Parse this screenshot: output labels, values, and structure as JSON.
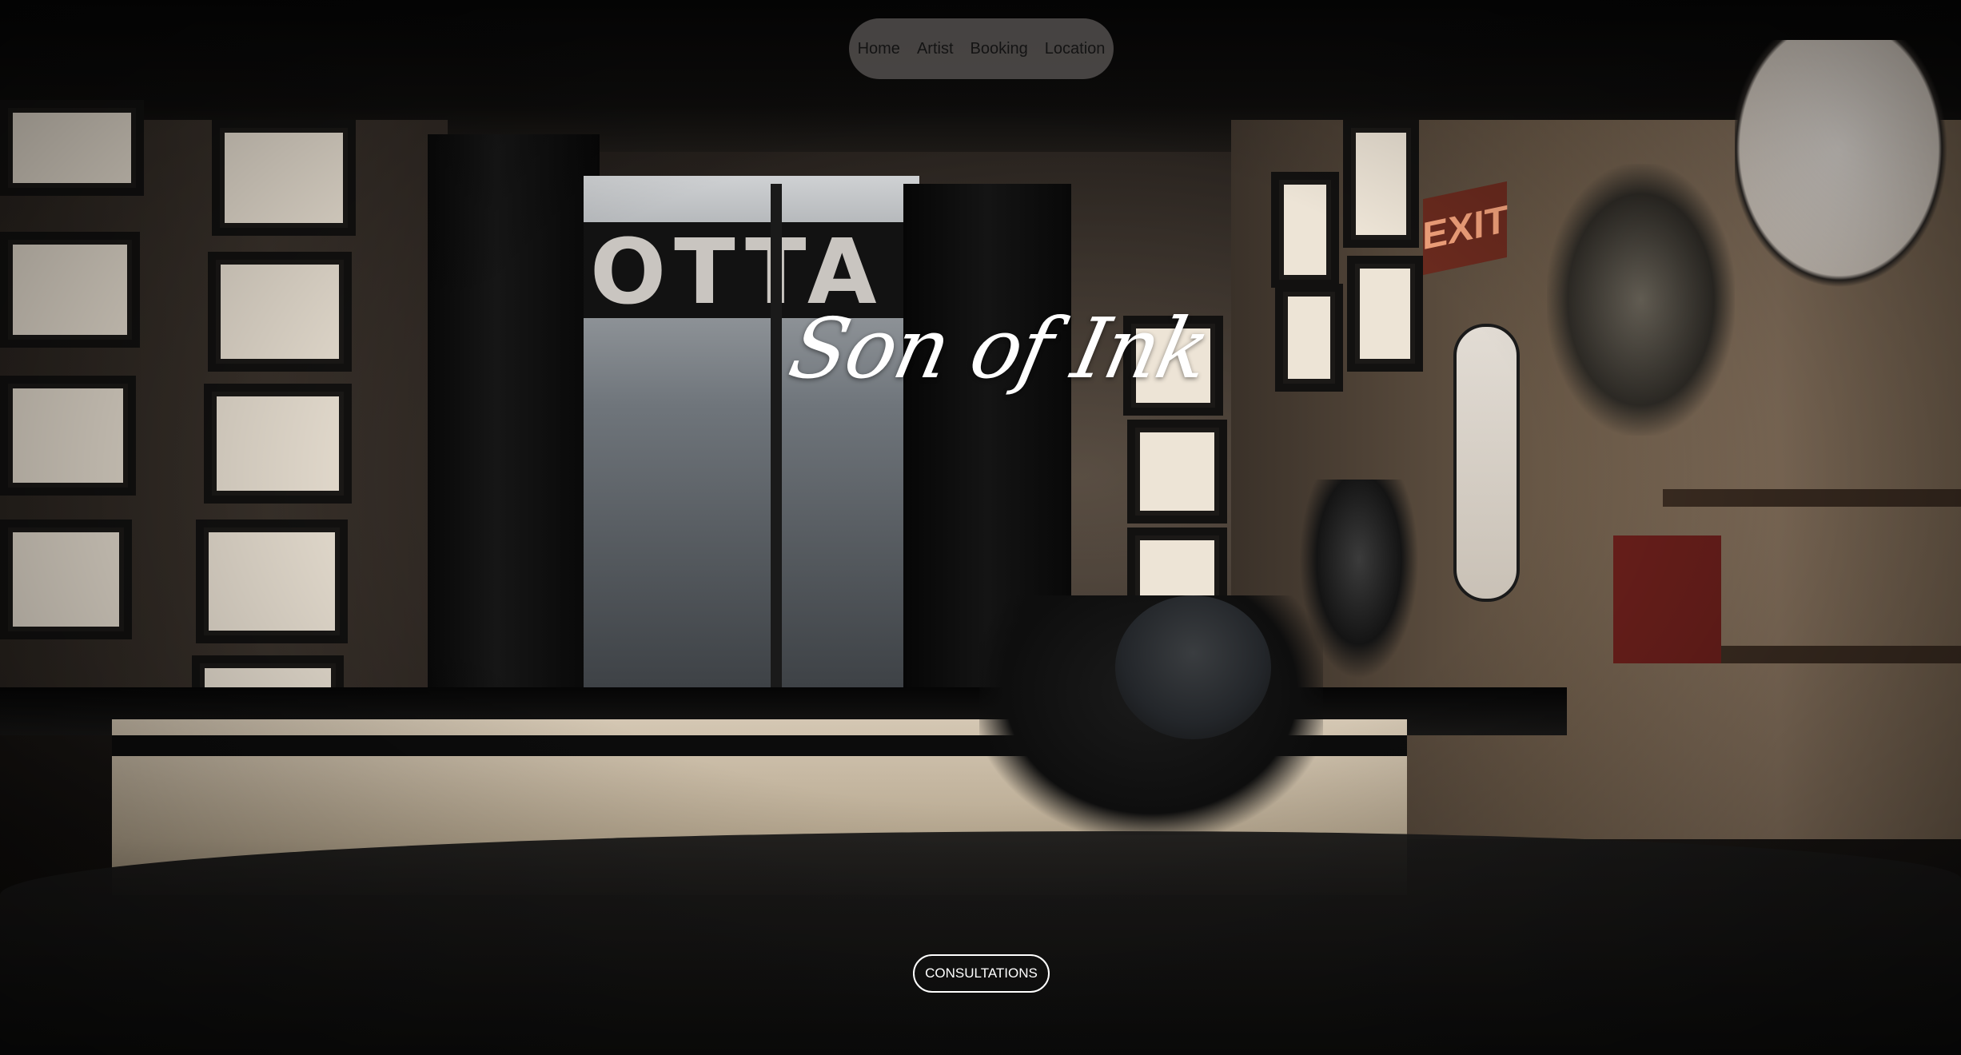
{
  "nav": {
    "items": [
      {
        "label": "Home"
      },
      {
        "label": "Artist"
      },
      {
        "label": "Booking"
      },
      {
        "label": "Location"
      }
    ]
  },
  "hero": {
    "title": "Son of Ink",
    "cta_label": "CONSULTATIONS",
    "scene": {
      "window_sign": "OTTA",
      "exit_sign": "EXIT"
    }
  }
}
